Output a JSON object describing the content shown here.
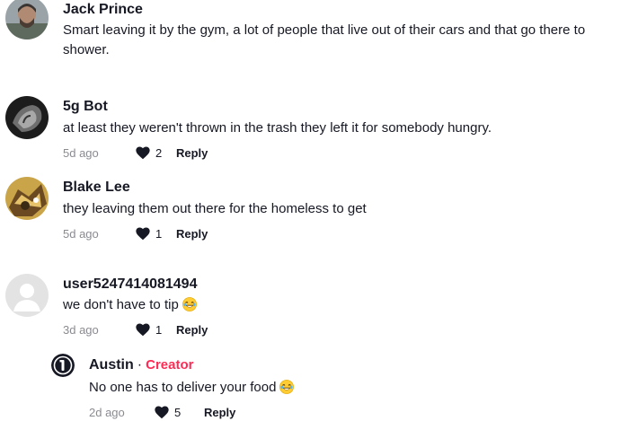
{
  "comments": [
    {
      "username": "Jack Prince",
      "text": "Smart leaving it by the gym, a lot of people that live out of their cars and that go there to shower."
    },
    {
      "username": "5g Bot",
      "text": "at least they weren't thrown in the trash they left it for somebody hungry.",
      "date": "5d ago",
      "likes": "2",
      "reply_label": "Reply"
    },
    {
      "username": "Blake Lee",
      "text": "they leaving them out there for the homeless to get",
      "date": "5d ago",
      "likes": "1",
      "reply_label": "Reply"
    },
    {
      "username": "user5247414081494",
      "text": "we don't have to tip",
      "date": "3d ago",
      "likes": "1",
      "reply_label": "Reply"
    },
    {
      "username": "Austin",
      "separator": "·",
      "creator_badge": "Creator",
      "text": "No one has to deliver your food",
      "date": "2d ago",
      "likes": "5",
      "reply_label": "Reply"
    }
  ],
  "colors": {
    "creator": "#fe2c55",
    "meta_gray": "#8a8b91",
    "text": "#161823"
  },
  "icons": {
    "like": "heart-icon",
    "laugh": "laughing-emoji-icon",
    "default_avatar": "default-avatar-icon"
  }
}
